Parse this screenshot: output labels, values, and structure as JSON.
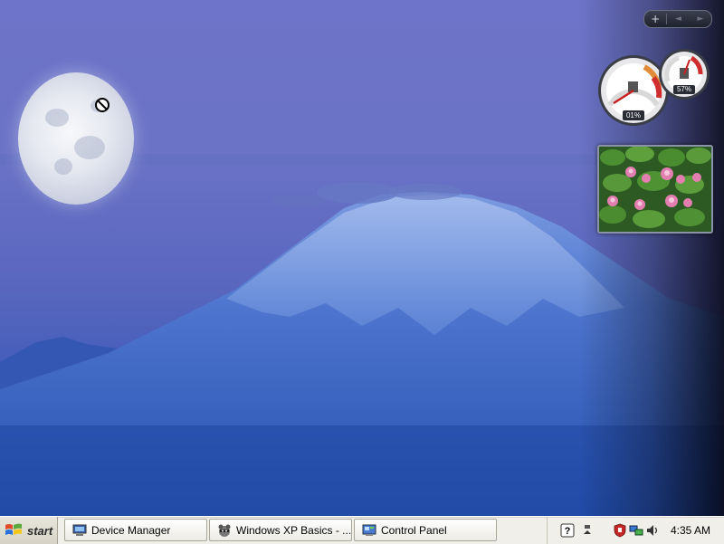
{
  "taskbar": {
    "start_label": "start",
    "tasks": [
      {
        "label": "Device Manager",
        "icon": "computer-icon"
      },
      {
        "label": "Windows XP Basics - ...",
        "icon": "raccoon-icon"
      },
      {
        "label": "Control Panel",
        "icon": "control-panel-icon"
      }
    ],
    "tray": {
      "icons": [
        "help-icon",
        "safely-remove-icon",
        "security-shield-icon",
        "network-icon",
        "volume-icon"
      ],
      "clock": "4:35 AM"
    }
  },
  "gadgets": {
    "controls": {
      "add": "+",
      "prev": "◄",
      "next": "►"
    },
    "cpu_meter": {
      "cpu": "01%",
      "memory": "57%"
    },
    "slideshow": {
      "subject": "water lilies photo"
    }
  },
  "colors": {
    "sky": "#6e74c9",
    "mountain": "#3a5fc0",
    "taskbar": "#f0efe9"
  }
}
